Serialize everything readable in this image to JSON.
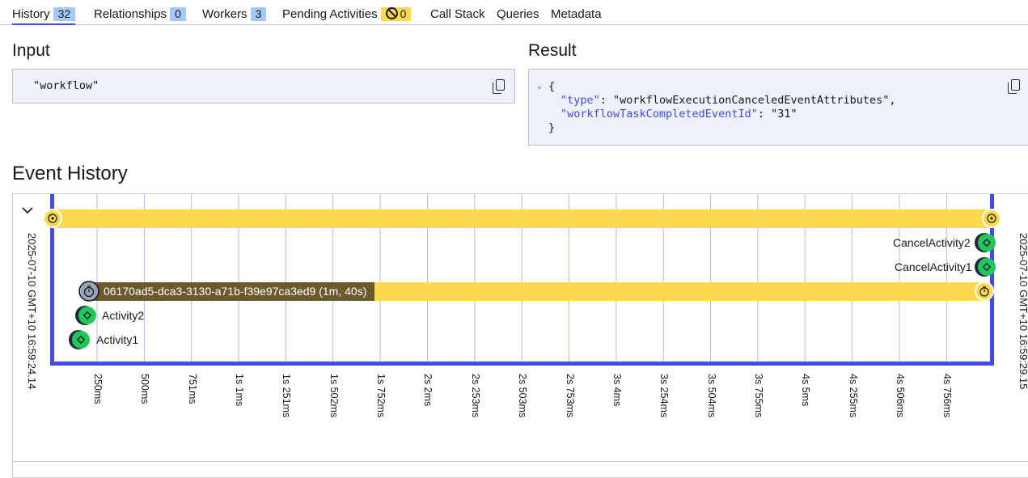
{
  "tabs": [
    {
      "label": "History",
      "badge": "32",
      "active": true
    },
    {
      "label": "Relationships",
      "badge": "0"
    },
    {
      "label": "Workers",
      "badge": "3"
    },
    {
      "label": "Pending Activities",
      "badge": "0"
    },
    {
      "label": "Call Stack"
    },
    {
      "label": "Queries"
    },
    {
      "label": "Metadata"
    }
  ],
  "input": {
    "heading": "Input",
    "value": "\"workflow\""
  },
  "result": {
    "heading": "Result",
    "open_brace": "{",
    "type_key": "\"type\"",
    "type_value": "\"workflowExecutionCanceledEventAttributes\",",
    "task_key": "\"workflowTaskCompletedEventId\"",
    "task_value": "\"31\"",
    "close_brace": "}"
  },
  "event_history": {
    "heading": "Event History",
    "start_time": "2025-07-10 GMT+10 16:59:24.14",
    "end_time": "2025-07-10 GMT+10 16:59:29.15",
    "ticks": [
      "250ms",
      "500ms",
      "751ms",
      "1s 1ms",
      "1s 251ms",
      "1s 502ms",
      "1s 752ms",
      "2s 2ms",
      "2s 253ms",
      "2s 503ms",
      "2s 753ms",
      "3s 4ms",
      "3s 254ms",
      "3s 504ms",
      "3s 755ms",
      "4s 5ms",
      "4s 255ms",
      "4s 506ms",
      "4s 756ms"
    ],
    "child_workflow": "06170ad5-dca3-3130-a71b-f39e97ca3ed9 (1m, 40s)",
    "events": [
      "CancelActivity2",
      "CancelActivity1",
      "Activity2",
      "Activity1"
    ]
  },
  "colors": {
    "accent": "#444ce7",
    "pending": "#fcd94d",
    "completed": "#22c55e"
  }
}
